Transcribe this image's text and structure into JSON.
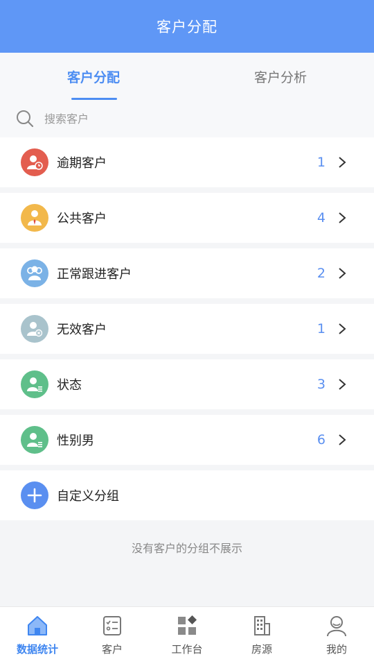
{
  "header": {
    "title": "客户分配"
  },
  "tabs": [
    {
      "label": "客户分配",
      "active": true
    },
    {
      "label": "客户分析",
      "active": false
    }
  ],
  "search": {
    "placeholder": "搜索客户",
    "value": ""
  },
  "groups": [
    {
      "label": "逾期客户",
      "count": "1",
      "icon": "overdue-user-icon",
      "color": "#e35d4f"
    },
    {
      "label": "公共客户",
      "count": "4",
      "icon": "public-user-icon",
      "color": "#f2b84b"
    },
    {
      "label": "正常跟进客户",
      "count": "2",
      "icon": "follow-users-icon",
      "color": "#7bb2e6"
    },
    {
      "label": "无效客户",
      "count": "1",
      "icon": "invalid-user-icon",
      "color": "#a9c3cc"
    },
    {
      "label": "状态",
      "count": "3",
      "icon": "user-list-icon",
      "color": "#5fbf8a"
    },
    {
      "label": "性别男",
      "count": "6",
      "icon": "user-list-icon",
      "color": "#5fbf8a"
    }
  ],
  "custom_group": {
    "label": "自定义分组",
    "icon": "plus-icon",
    "color": "#5a8ff0"
  },
  "note": "没有客户的分组不展示",
  "nav": [
    {
      "label": "数据统计",
      "icon": "home-icon",
      "active": true
    },
    {
      "label": "客户",
      "icon": "checklist-icon",
      "active": false
    },
    {
      "label": "工作台",
      "icon": "grid-icon",
      "active": false
    },
    {
      "label": "房源",
      "icon": "building-icon",
      "active": false
    },
    {
      "label": "我的",
      "icon": "profile-icon",
      "active": false
    }
  ],
  "colors": {
    "primary": "#5f97f6",
    "accent": "#4d8df2"
  }
}
